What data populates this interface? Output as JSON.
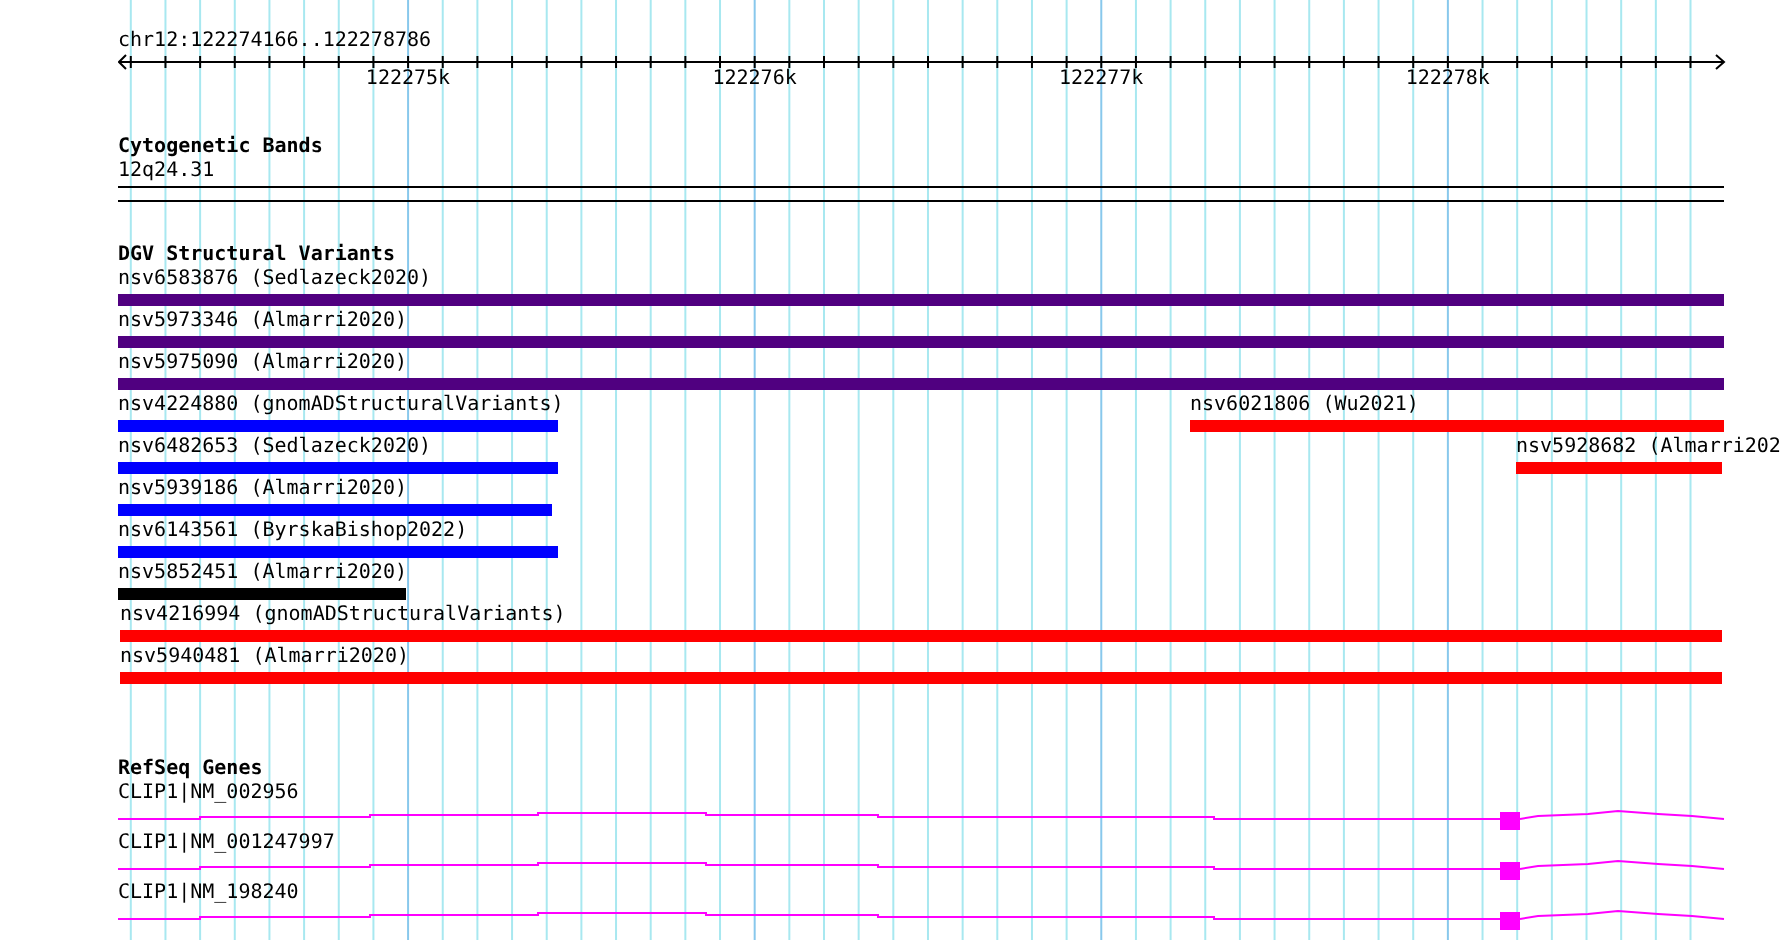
{
  "location": "chr12:122274166..122278786",
  "ruler": {
    "ticks": [
      "122275k",
      "122276k",
      "122277k",
      "122278k"
    ]
  },
  "tracks": [
    {
      "kind": "bands",
      "title": "Cytogenetic Bands",
      "label": "12q24.31"
    },
    {
      "kind": "variants",
      "title": "DGV Structural Variants",
      "rows": [
        {
          "features": [
            {
              "label": "nsv6583876 (Sedlazeck2020)",
              "color": "#500080"
            }
          ]
        },
        {
          "features": [
            {
              "label": "nsv5973346 (Almarri2020)",
              "color": "#500080"
            }
          ]
        },
        {
          "features": [
            {
              "label": "nsv5975090 (Almarri2020)",
              "color": "#500080"
            }
          ]
        },
        {
          "features": [
            {
              "label": "nsv4224880 (gnomADStructuralVariants)",
              "color": "#0000ff"
            },
            {
              "label": "nsv6021806 (Wu2021)",
              "color": "#ff0000"
            }
          ]
        },
        {
          "features": [
            {
              "label": "nsv6482653 (Sedlazeck2020)",
              "color": "#0000ff"
            },
            {
              "label": "nsv5928682 (Almarri202",
              "color": "#ff0000"
            }
          ]
        },
        {
          "features": [
            {
              "label": "nsv5939186 (Almarri2020)",
              "color": "#0000ff"
            }
          ]
        },
        {
          "features": [
            {
              "label": "nsv6143561 (ByrskaBishop2022)",
              "color": "#0000ff"
            }
          ]
        },
        {
          "features": [
            {
              "label": "nsv5852451 (Almarri2020)",
              "color": "#000000"
            }
          ]
        },
        {
          "features": [
            {
              "label": "nsv4216994 (gnomADStructuralVariants)",
              "color": "#ff0000"
            }
          ]
        },
        {
          "features": [
            {
              "label": "nsv5940481 (Almarri2020)",
              "color": "#ff0000"
            }
          ]
        }
      ]
    },
    {
      "kind": "genes",
      "title": "RefSeq Genes",
      "genes": [
        {
          "label": "CLIP1|NM_002956"
        },
        {
          "label": "CLIP1|NM_001247997"
        },
        {
          "label": "CLIP1|NM_198240"
        }
      ]
    }
  ]
}
